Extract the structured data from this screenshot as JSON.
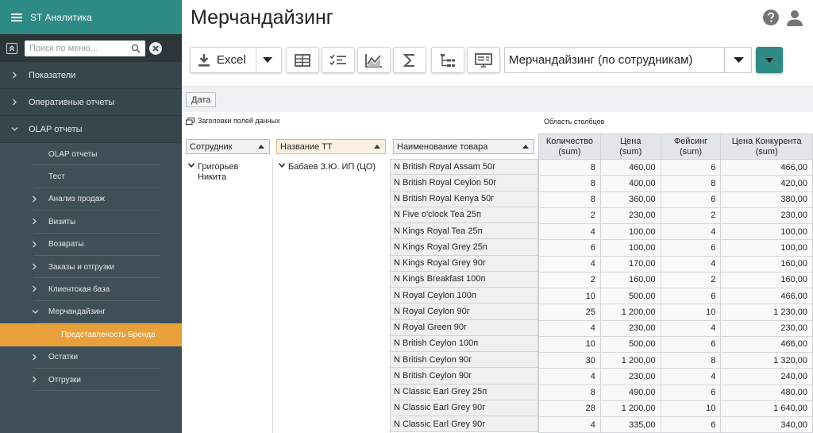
{
  "app": {
    "title": "ST Аналитика"
  },
  "search": {
    "placeholder": "Поиск по меню..."
  },
  "nav": {
    "top_items": [
      "Показатели",
      "Оперативные отчеты",
      "OLAP отчеты"
    ],
    "olap_items": [
      {
        "label": "OLAP отчеты",
        "chevron": false
      },
      {
        "label": "Тест",
        "chevron": false
      },
      {
        "label": "Анализ продаж",
        "chevron": true
      },
      {
        "label": "Визиты",
        "chevron": true
      },
      {
        "label": "Возвраты",
        "chevron": true
      },
      {
        "label": "Заказы и отгрузки",
        "chevron": true
      },
      {
        "label": "Клиентская база",
        "chevron": true
      },
      {
        "label": "Мерчандайзинг",
        "chevron": "down"
      }
    ],
    "active_item": "Представленость Бренда",
    "after_items": [
      "Остатки",
      "Отгрузки"
    ]
  },
  "page": {
    "title": "Мерчандайзинг"
  },
  "toolbar": {
    "excel_label": "Excel",
    "view_select_value": "Мерчандайзинг (по сотрудникам)"
  },
  "filters": {
    "date_label": "Дата"
  },
  "pivot": {
    "row_area_label": "Заголовки полей данных",
    "col_area_label": "Область столбцов",
    "row_headers": [
      "Сотрудник",
      "Название ТТ",
      "Наименование товара"
    ],
    "employee": "Григорьев Никита",
    "store": "Бабаев З.Ю. ИП (ЦО)",
    "columns": [
      {
        "name": "Количество",
        "agg": "(sum)"
      },
      {
        "name": "Цена",
        "agg": "(sum)"
      },
      {
        "name": "Фейсинг",
        "agg": "(sum)"
      },
      {
        "name": "Цена Конкурента",
        "agg": "(sum)"
      }
    ],
    "rows": [
      {
        "product": "N British Royal Assam 50г",
        "qty": "8",
        "price": "460,00",
        "facing": "6",
        "comp": "466,00"
      },
      {
        "product": "N British Royal Ceylon 50г",
        "qty": "8",
        "price": "400,00",
        "facing": "8",
        "comp": "420,00"
      },
      {
        "product": "N British Royal Kenya 50г",
        "qty": "8",
        "price": "360,00",
        "facing": "6",
        "comp": "380,00"
      },
      {
        "product": "N Five o'clock Tea 25п",
        "qty": "2",
        "price": "230,00",
        "facing": "2",
        "comp": "230,00"
      },
      {
        "product": "N Kings Royal Tea 25п",
        "qty": "4",
        "price": "100,00",
        "facing": "4",
        "comp": "100,00"
      },
      {
        "product": "N Kings Royal Grey 25п",
        "qty": "6",
        "price": "100,00",
        "facing": "6",
        "comp": "100,00"
      },
      {
        "product": "N Kings Royal Grey 90г",
        "qty": "4",
        "price": "170,00",
        "facing": "4",
        "comp": "160,00"
      },
      {
        "product": "N Kings Breakfast 100п",
        "qty": "2",
        "price": "160,00",
        "facing": "2",
        "comp": "160,00"
      },
      {
        "product": "N Royal Ceylon 100п",
        "qty": "10",
        "price": "500,00",
        "facing": "6",
        "comp": "466,00"
      },
      {
        "product": "N Royal Ceylon 90г",
        "qty": "25",
        "price": "1 200,00",
        "facing": "10",
        "comp": "1 230,00"
      },
      {
        "product": "N Royal Green 90г",
        "qty": "4",
        "price": "230,00",
        "facing": "4",
        "comp": "230,00"
      },
      {
        "product": "N British Ceylon 100п",
        "qty": "10",
        "price": "500,00",
        "facing": "6",
        "comp": "466,00"
      },
      {
        "product": "N British Ceylon 90г",
        "qty": "30",
        "price": "1 200,00",
        "facing": "8",
        "comp": "1 320,00"
      },
      {
        "product": "N British Ceylon 90г",
        "qty": "4",
        "price": "230,00",
        "facing": "4",
        "comp": "240,00"
      },
      {
        "product": "N Classic Earl Grey 25п",
        "qty": "8",
        "price": "490,00",
        "facing": "6",
        "comp": "480,00"
      },
      {
        "product": "N Classic Earl Grey 90г",
        "qty": "28",
        "price": "1 200,00",
        "facing": "10",
        "comp": "1 640,00"
      },
      {
        "product": "N Classic Earl Grey 90г",
        "qty": "4",
        "price": "335,00",
        "facing": "6",
        "comp": "340,00"
      }
    ]
  },
  "colors": {
    "teal": "#2e8a85",
    "sidebar": "#3f4f57",
    "active": "#e8a03a"
  }
}
